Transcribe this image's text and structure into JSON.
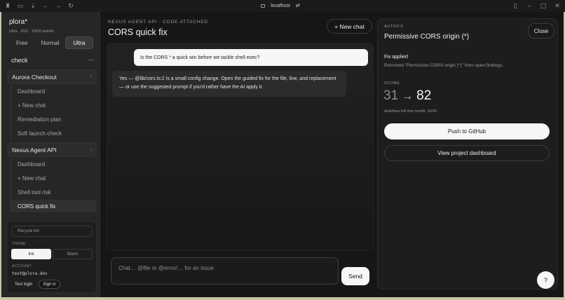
{
  "browser": {
    "url": "localhost"
  },
  "sidebar": {
    "brand": "plora*",
    "plan_line": "Ultra · 3/10 · 19/20 autofix",
    "tiers": [
      "Free",
      "Normal",
      "Ultra"
    ],
    "active_tier": "Ultra",
    "search_text": "check",
    "collapse_glyph": "—",
    "projects": [
      {
        "name": "Aurora Checkout",
        "items": [
          "Dashboard",
          "+ New chat",
          "Remediation plan",
          "Soft launch check"
        ]
      },
      {
        "name": "Nexus Agent API",
        "items": [
          "Dashboard",
          "+ New chat",
          "Shell tool risk",
          "CORS quick fix"
        ]
      }
    ],
    "active_item": "CORS quick fix",
    "recycle_bin": "Recycle bin",
    "theme_label": "THEME",
    "themes": [
      "Ink",
      "Warm"
    ],
    "active_theme": "Ink",
    "account_label": "ACCOUNT",
    "account_email": "test@plora.dev",
    "test_login": "Test login",
    "sign_in": "Sign in"
  },
  "chat": {
    "eyebrow": "NEXUS AGENT API · CODE ATTACHED",
    "title": "CORS quick fix",
    "new_chat": "+ New chat",
    "user_message": "Is the CORS * a quick win before we tackle shell exec?",
    "ai_message": "Yes — @lib/cors.ts:2 is a small config change. Open the guided fix for the file, line, and replacement — or use the suggested prompt if you'd rather have the AI apply it.",
    "composer_placeholder": "Chat… @file or @error/… for an issue",
    "send": "Send"
  },
  "autofix": {
    "eyebrow": "AUTOFIX",
    "title": "Permissive CORS origin (*)",
    "close": "Close",
    "fix_heading": "Fix applied",
    "fix_desc": "Removed \"Permissive CORS origin (*)\" from open findings.",
    "score_label": "SCORE",
    "score_from": "31",
    "score_arrow": "→",
    "score_to": "82",
    "autofixes_left": "Autofixes left this month: 19/20",
    "push": "Push to GitHub",
    "view_dashboard": "View project dashboard"
  },
  "help": "?"
}
